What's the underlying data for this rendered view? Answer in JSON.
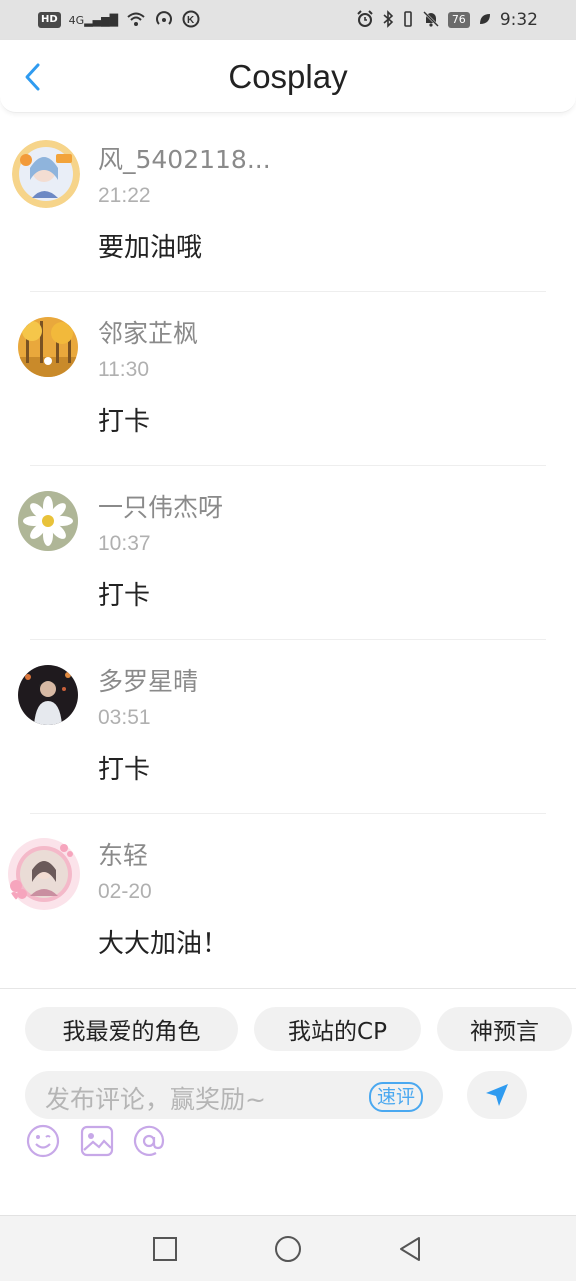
{
  "status_bar": {
    "left_icons": [
      "HD",
      "4G",
      "signal-icon",
      "wifi-icon",
      "hotspot-icon",
      "k-icon"
    ],
    "battery": "76",
    "time": "9:32"
  },
  "header": {
    "title": "Cosplay"
  },
  "comments": [
    {
      "username": "风_5402118...",
      "time": "21:22",
      "content": "要加油哦",
      "avatar": "anime-girl-avatar"
    },
    {
      "username": "邻家芷枫",
      "time": "11:30",
      "content": "打卡",
      "avatar": "autumn-trees-avatar"
    },
    {
      "username": "一只伟杰呀",
      "time": "10:37",
      "content": "打卡",
      "avatar": "daisy-avatar"
    },
    {
      "username": "多罗星晴",
      "time": "03:51",
      "content": "打卡",
      "avatar": "person-night-avatar"
    },
    {
      "username": "东轻",
      "time": "02-20",
      "content": "大大加油！",
      "avatar": "pink-frame-avatar"
    }
  ],
  "composer": {
    "chips": [
      "我最爱的角色",
      "我站的CP",
      "神预言"
    ],
    "placeholder": "发布评论，赢奖励~",
    "quick_badge": "速评",
    "tools": [
      "emoji-icon",
      "image-icon",
      "at-icon"
    ]
  },
  "colors": {
    "accent": "#4aa8f0",
    "tool_icon": "#c7a8e8",
    "send": "#2f9bf0"
  }
}
